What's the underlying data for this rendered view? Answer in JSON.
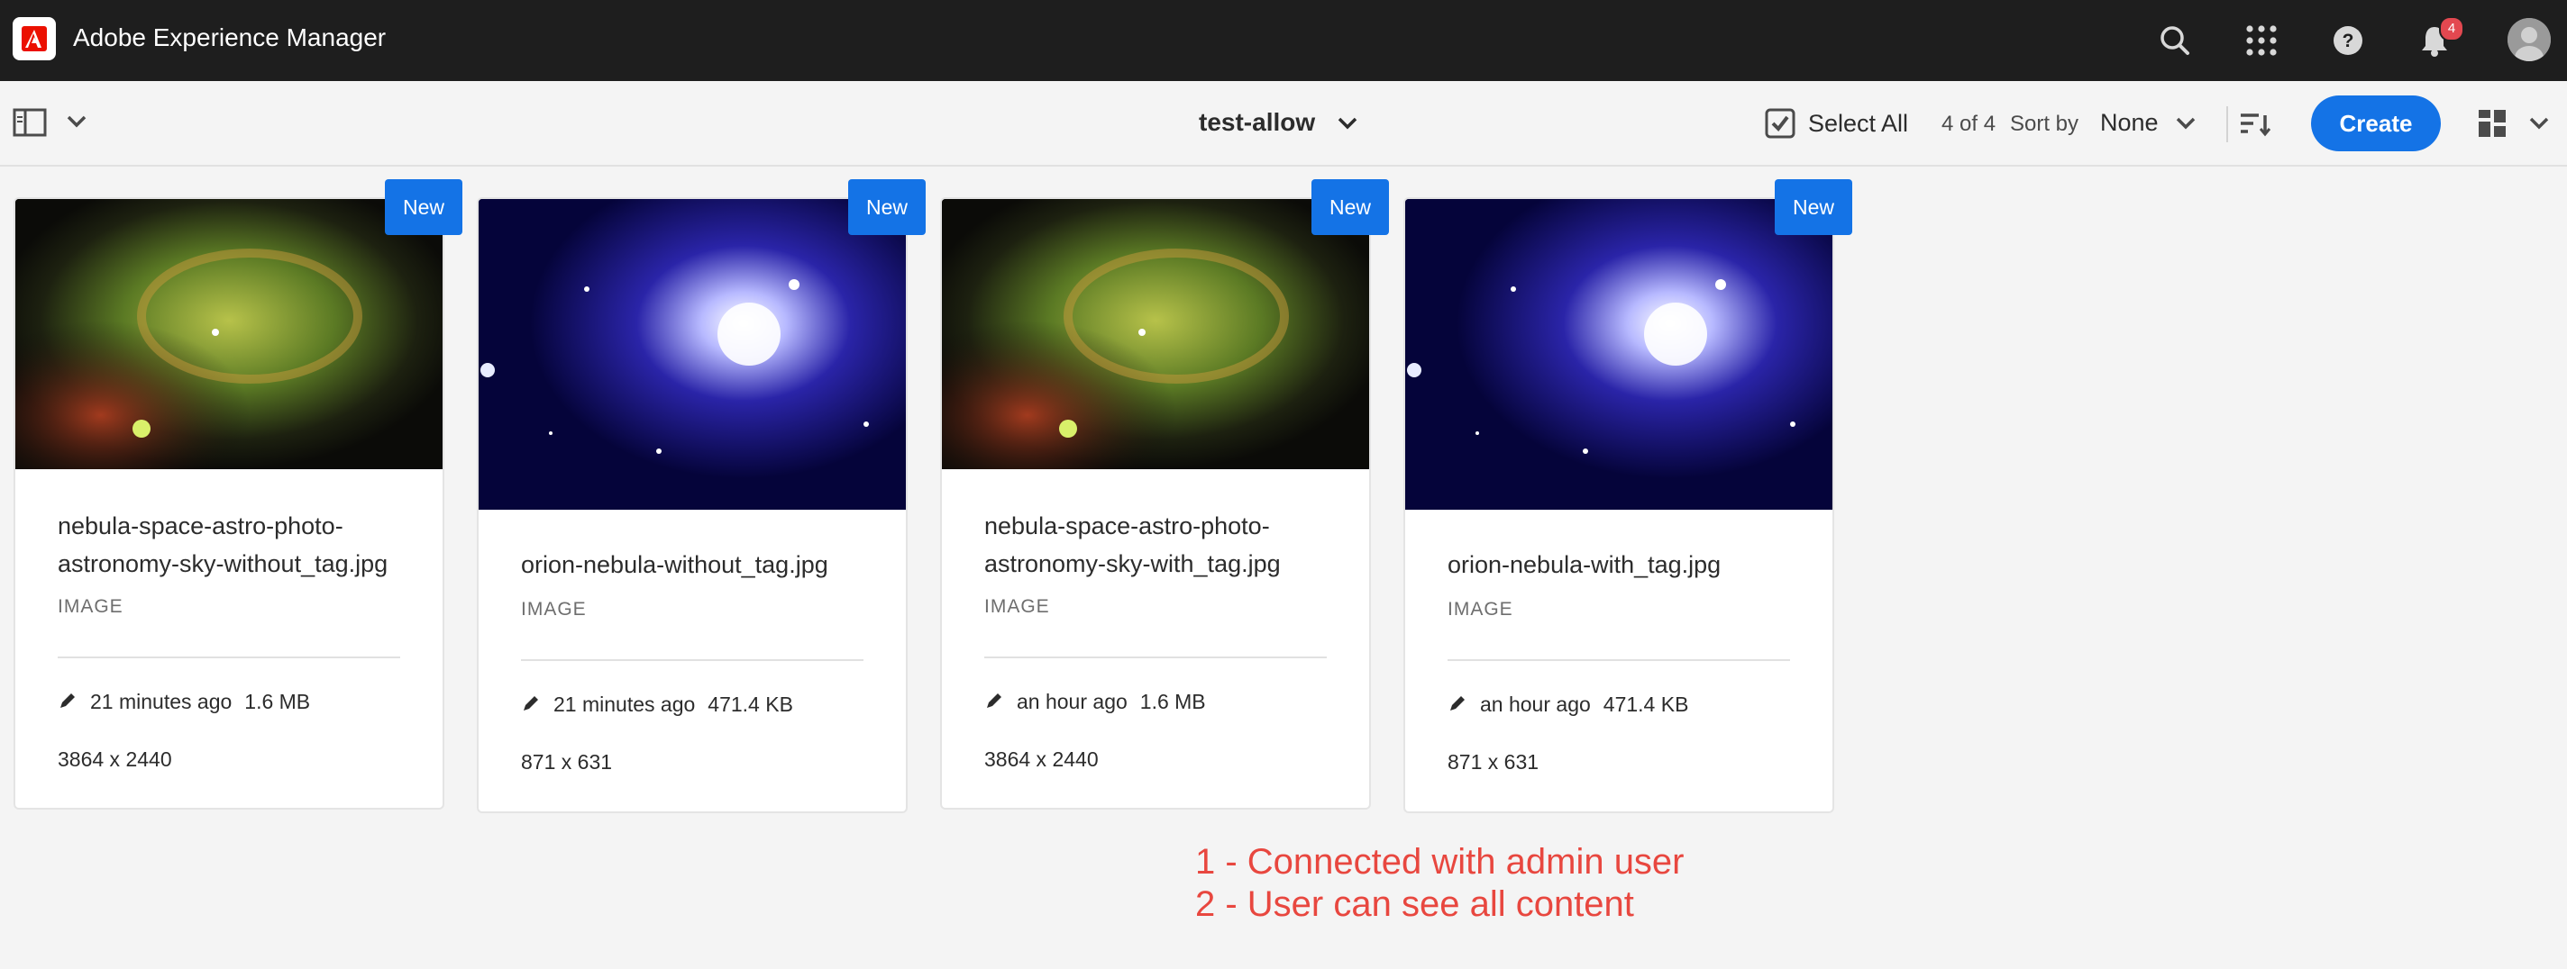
{
  "shell": {
    "app_title": "Adobe Experience Manager",
    "notification_count": "4",
    "icons": [
      "search-icon",
      "apps-grid-icon",
      "help-icon",
      "bell-icon",
      "avatar"
    ]
  },
  "actionbar": {
    "folder_title": "test-allow",
    "select_all_label": "Select All",
    "count": "4 of 4",
    "sort_by_label": "Sort by",
    "sort_value": "None",
    "create_label": "Create"
  },
  "cards": [
    {
      "badge": "New",
      "title": "nebula-space-astro-photo-astronomy-sky-without_tag.jpg",
      "type": "IMAGE",
      "modified": "21 minutes ago",
      "size": "1.6 MB",
      "dimensions": "3864 x 2440"
    },
    {
      "badge": "New",
      "title": "orion-nebula-without_tag.jpg",
      "type": "IMAGE",
      "modified": "21 minutes ago",
      "size": "471.4 KB",
      "dimensions": "871 x 631"
    },
    {
      "badge": "New",
      "title": "nebula-space-astro-photo-astronomy-sky-with_tag.jpg",
      "type": "IMAGE",
      "modified": "an hour ago",
      "size": "1.6 MB",
      "dimensions": "3864 x 2440"
    },
    {
      "badge": "New",
      "title": "orion-nebula-with_tag.jpg",
      "type": "IMAGE",
      "modified": "an hour ago",
      "size": "471.4 KB",
      "dimensions": "871 x 631"
    }
  ],
  "annotation": {
    "line1": "1 - Connected with admin user",
    "line2": "2 - User can see all content"
  },
  "colors": {
    "accent": "#1473e6",
    "shell": "#1e1e1e",
    "annotation": "#e8473f",
    "badge": "#e34850"
  }
}
